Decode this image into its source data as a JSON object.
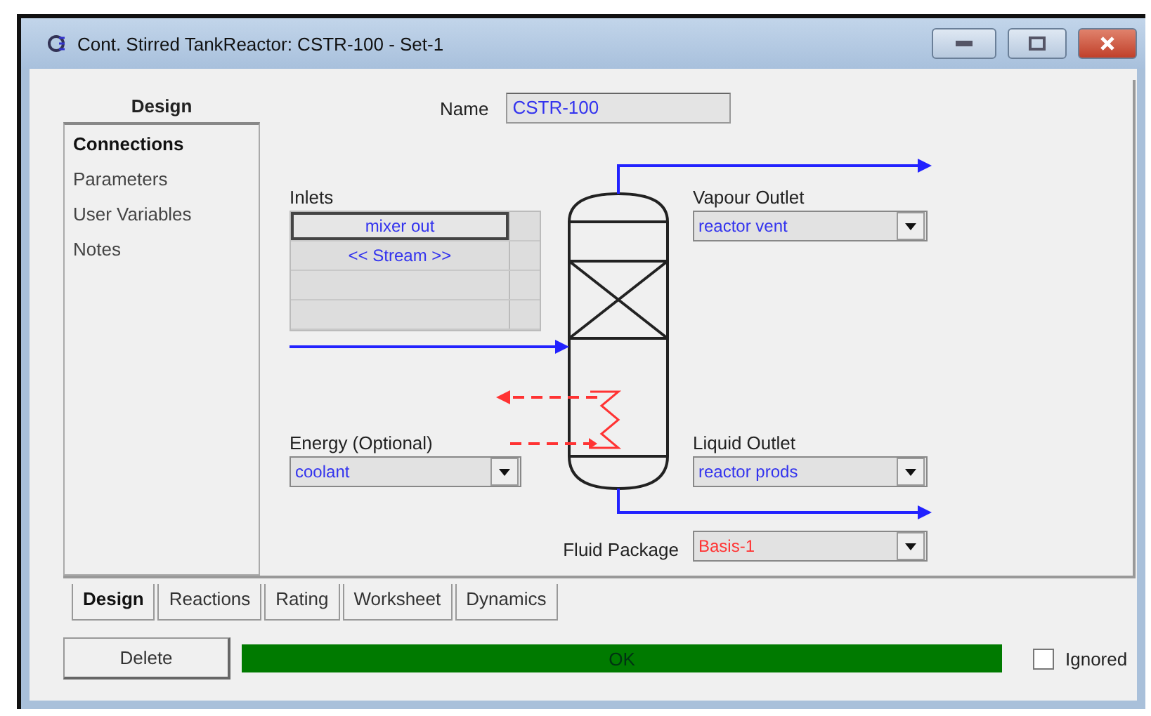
{
  "window": {
    "title": "Cont. Stirred TankReactor: CSTR-100 - Set-1"
  },
  "sidebar": {
    "heading": "Design",
    "items": [
      {
        "label": "Connections",
        "selected": true
      },
      {
        "label": "Parameters",
        "selected": false
      },
      {
        "label": "User Variables",
        "selected": false
      },
      {
        "label": "Notes",
        "selected": false
      }
    ]
  },
  "name": {
    "label": "Name",
    "value": "CSTR-100"
  },
  "inlets": {
    "label": "Inlets",
    "rows": [
      {
        "value": "mixer out",
        "selected": true
      },
      {
        "value": "<< Stream >>",
        "selected": false
      }
    ]
  },
  "vapour_outlet": {
    "label": "Vapour Outlet",
    "value": "reactor vent"
  },
  "energy": {
    "label": "Energy (Optional)",
    "value": "coolant"
  },
  "liquid_outlet": {
    "label": "Liquid Outlet",
    "value": "reactor prods"
  },
  "fluid_package": {
    "label": "Fluid Package",
    "value": "Basis-1"
  },
  "tabs": [
    {
      "label": "Design",
      "selected": true
    },
    {
      "label": "Reactions",
      "selected": false
    },
    {
      "label": "Rating",
      "selected": false
    },
    {
      "label": "Worksheet",
      "selected": false
    },
    {
      "label": "Dynamics",
      "selected": false
    }
  ],
  "footer": {
    "delete": "Delete",
    "status": "OK",
    "ignored": {
      "label": "Ignored",
      "checked": false
    }
  }
}
